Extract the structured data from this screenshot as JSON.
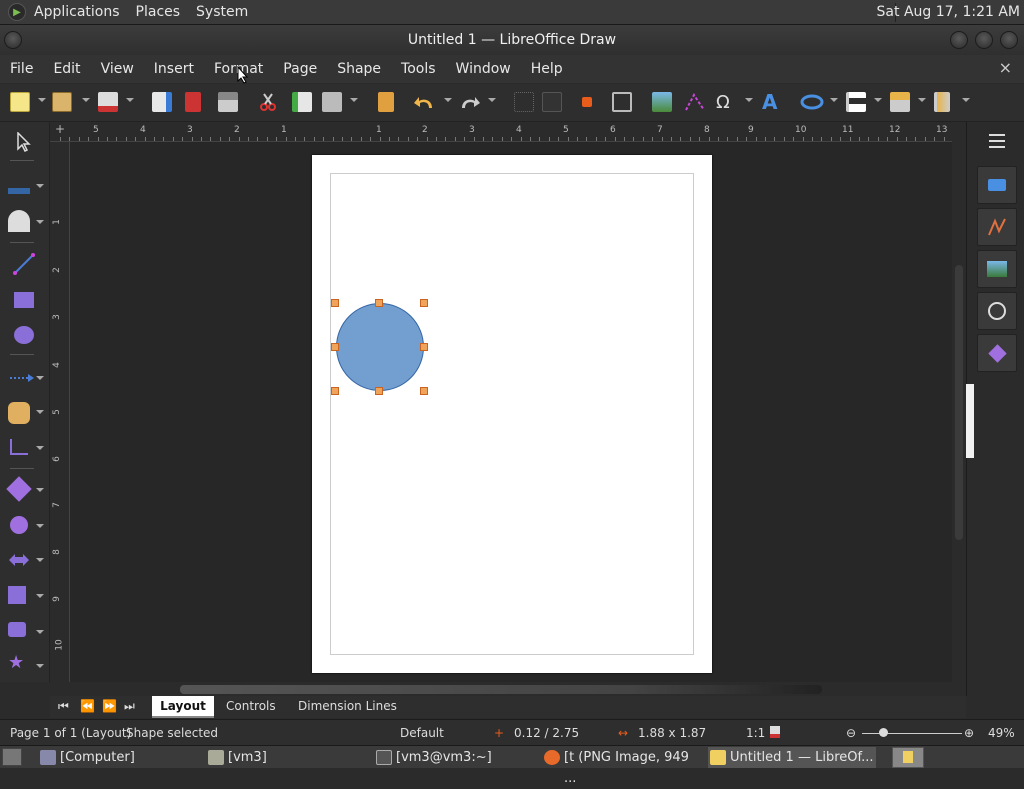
{
  "top_panel": {
    "menus": [
      "Applications",
      "Places",
      "System"
    ],
    "clock": "Sat Aug 17,  1:21 AM"
  },
  "window": {
    "title": "Untitled 1 — LibreOffice Draw"
  },
  "menubar": {
    "items": [
      "File",
      "Edit",
      "View",
      "Insert",
      "Format",
      "Page",
      "Shape",
      "Tools",
      "Window",
      "Help"
    ],
    "close_symbol": "×"
  },
  "ruler": {
    "h_numbers": [
      "5",
      "4",
      "3",
      "2",
      "1",
      "1",
      "2",
      "3",
      "4",
      "5",
      "6",
      "7",
      "8",
      "9",
      "10",
      "11",
      "12",
      "13"
    ],
    "v_numbers": [
      "1",
      "2",
      "3",
      "4",
      "5",
      "6",
      "7",
      "8",
      "9",
      "10"
    ]
  },
  "tabs": {
    "items": [
      "Layout",
      "Controls",
      "Dimension Lines"
    ],
    "active": "Layout"
  },
  "status": {
    "page": "Page 1 of 1 (Layout)",
    "selection": "Shape selected",
    "master": "Default",
    "position": "0.12 / 2.75",
    "size": "1.88 x 1.87",
    "scale": "1:1",
    "zoom": "49%"
  },
  "taskbar": {
    "items": [
      {
        "label": "[Computer]"
      },
      {
        "label": "[vm3]"
      },
      {
        "label": "[vm3@vm3:~]"
      },
      {
        "label": "[t (PNG Image, 949 ..."
      },
      {
        "label": "Untitled 1 — LibreOf..."
      }
    ]
  },
  "icons": [
    "search-icon"
  ],
  "colors": {
    "shape_fill": "#729fcf",
    "shape_border": "#3465a4",
    "handle": "#f0a35a"
  }
}
